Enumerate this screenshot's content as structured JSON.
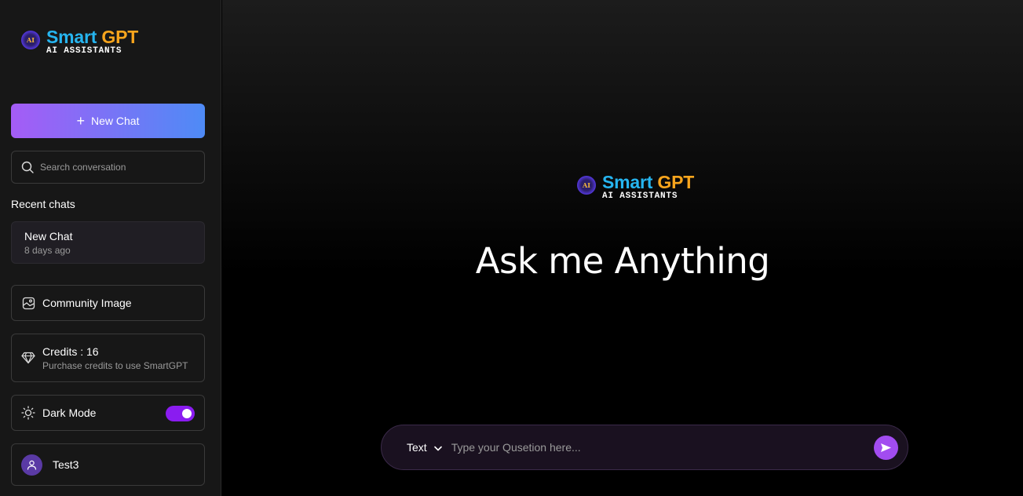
{
  "brand": {
    "logo_badge": "AI",
    "title_part1": "Smart",
    "title_part2": "GPT",
    "subtitle": "AI ASSISTANTS",
    "colors": {
      "smart": "#26b5f0",
      "gpt": "#f8a51d"
    }
  },
  "sidebar": {
    "new_chat_label": "New Chat",
    "search_placeholder": "Search conversation",
    "recent_title": "Recent chats",
    "recent_chats": [
      {
        "title": "New Chat",
        "time": "8 days ago"
      }
    ],
    "community_label": "Community Image",
    "credits_label": "Credits : 16",
    "credits_sub": "Purchase credits to use SmartGPT",
    "dark_mode_label": "Dark Mode",
    "dark_mode_on": true,
    "user_name": "Test3"
  },
  "main": {
    "heading": "Ask me Anything",
    "mode_selected": "Text",
    "input_placeholder": "Type your Qusetion here..."
  },
  "colors": {
    "accent_purple": "#a24cf0",
    "toggle": "#8a1cf0",
    "new_chat_gradient_start": "#a55cf6",
    "new_chat_gradient_end": "#4e8bf6"
  }
}
